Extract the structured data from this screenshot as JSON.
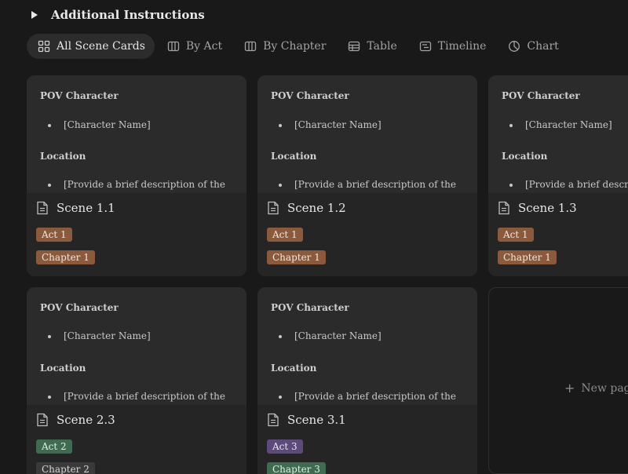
{
  "toggle": {
    "title": "Additional Instructions"
  },
  "tabs": [
    {
      "label": "All Scene Cards",
      "icon": "grid-icon",
      "active": true
    },
    {
      "label": "By Act",
      "icon": "board-icon"
    },
    {
      "label": "By Chapter",
      "icon": "board-icon"
    },
    {
      "label": "Table",
      "icon": "table-icon"
    },
    {
      "label": "Timeline",
      "icon": "timeline-icon"
    },
    {
      "label": "Chart",
      "icon": "pie-chart-icon"
    }
  ],
  "preview": {
    "pov_heading": "POV Character",
    "pov_value": "[Character Name]",
    "location_heading": "Location",
    "location_value": "[Provide a brief description of the"
  },
  "cards": [
    {
      "title": "Scene 1.1",
      "act": "Act 1",
      "chapter": "Chapter 1"
    },
    {
      "title": "Scene 1.2",
      "act": "Act 1",
      "chapter": "Chapter 1"
    },
    {
      "title": "Scene 1.3",
      "act": "Act 1",
      "chapter": "Chapter 1"
    },
    {
      "title": "Scene 2.3",
      "act": "Act 2",
      "chapter": "Chapter 2"
    },
    {
      "title": "Scene 3.1",
      "act": "Act 3",
      "chapter": "Chapter 3"
    }
  ],
  "new_page_label": "New page",
  "colors": {
    "act1": "#8b5a3c",
    "act2": "#3e6b51",
    "act3": "#5b4a7a"
  }
}
